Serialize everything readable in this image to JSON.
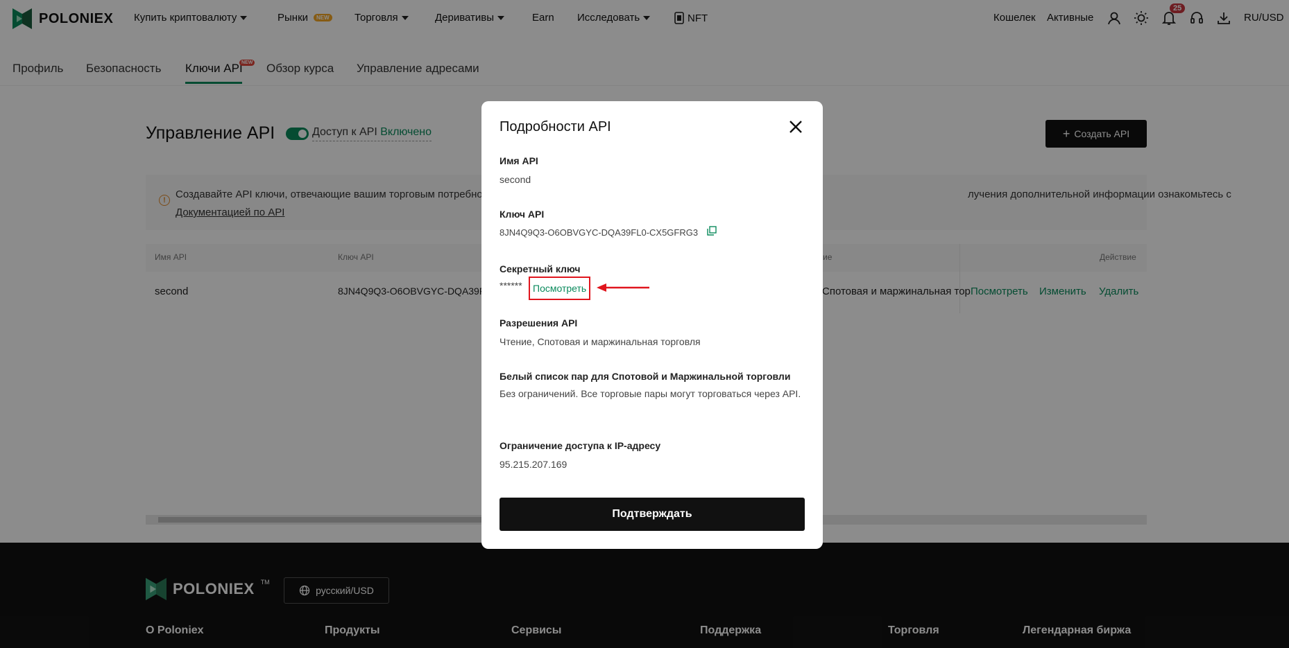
{
  "nav": {
    "logo_text": "POLONIEX",
    "buy_crypto": "Купить криптовалюту",
    "markets": "Рынки",
    "markets_badge": "NEW",
    "trading": "Торговля",
    "derivatives": "Деривативы",
    "earn": "Earn",
    "research": "Исследовать",
    "nft": "NFT",
    "wallet": "Кошелек",
    "assets": "Активные",
    "notification_count": "25",
    "locale": "RU/USD"
  },
  "subtabs": {
    "profile": "Профиль",
    "security": "Безопасность",
    "api_keys": "Ключи API",
    "api_keys_badge": "NEW",
    "course_review": "Обзор курса",
    "address_management": "Управление адресами"
  },
  "main": {
    "title": "Управление API",
    "api_access_label": "Доступ к API",
    "api_access_state": "Включено",
    "create_button": "Создать API",
    "info_text_left": "Создавайте API ключи, отвечающие вашим торговым потребност",
    "info_text_right": "лучения дополнительной информации ознакомьтесь с",
    "info_link": "Документацией по API",
    "info_link_suffix": ".",
    "table": {
      "col_name": "Имя API",
      "col_key": "Ключ API",
      "col_perm_fragment": "ие",
      "col_action": "Действие",
      "row": {
        "name": "second",
        "key": "8JN4Q9Q3-O6OBVGYC-DQA39FL",
        "perm": "Спотовая и маржинальная тор",
        "view": "Посмотреть",
        "edit": "Изменить",
        "delete": "Удалить"
      }
    }
  },
  "footer": {
    "logo_text": "POLONIEX",
    "tm": "TM",
    "lang_button": "русский/USD",
    "col_about": "О Poloniex",
    "col_products": "Продукты",
    "col_services": "Сервисы",
    "col_support": "Поддержка",
    "col_trading": "Торговля",
    "col_legend": "Легендарная биржа"
  },
  "modal": {
    "title": "Подробности API",
    "name_label": "Имя API",
    "name_value": "second",
    "key_label": "Ключ API",
    "key_value": "8JN4Q9Q3-O6OBVGYC-DQA39FL0-CX5GFRG3",
    "secret_label": "Секретный ключ",
    "secret_masked": "******",
    "secret_view": "Посмотреть",
    "perm_label": "Разрешения API",
    "perm_value": "Чтение, Спотовая и маржинальная торговля",
    "whitelist_label": "Белый список пар для Спотовой и Маржинальной торговли",
    "whitelist_value": "Без ограничений. Все торговые пары могут торговаться через API.",
    "ip_label": "Ограничение доступа к IP-адресу",
    "ip_value": "95.215.207.169",
    "confirm_button": "Подтверждать"
  },
  "colors": {
    "accent_green": "#0a8a5c",
    "highlight_red": "#e0151d",
    "badge_orange": "#f5a623"
  }
}
